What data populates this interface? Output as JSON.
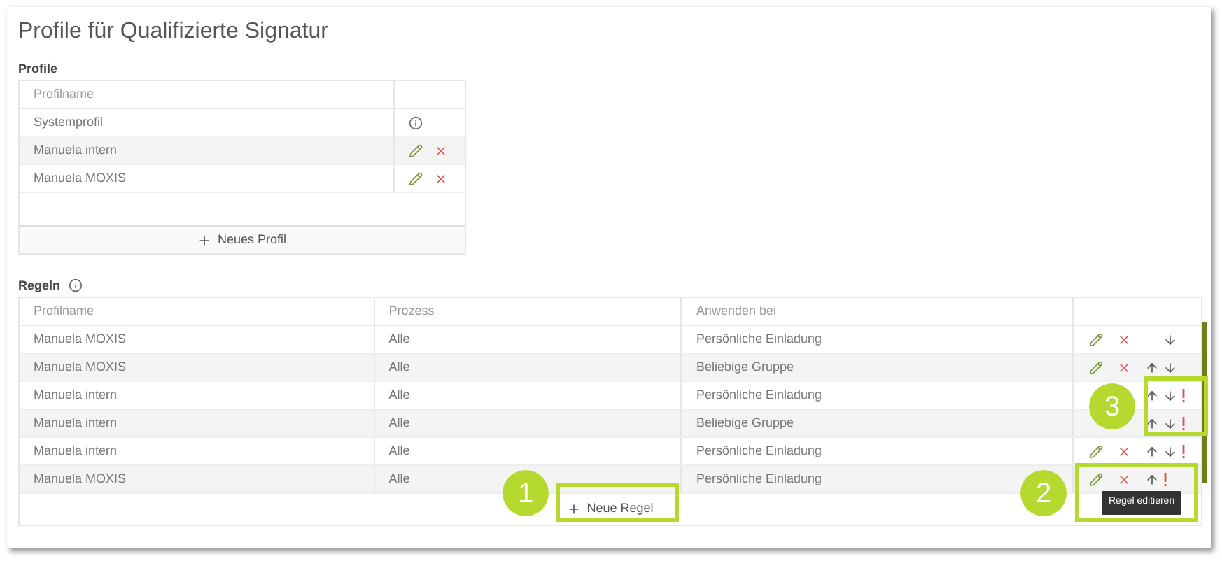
{
  "title": "Profile für Qualifizierte Signatur",
  "profiles": {
    "heading": "Profile",
    "columns": [
      "Profilname"
    ],
    "rows": [
      {
        "name": "Systemprofil",
        "kind": "system"
      },
      {
        "name": "Manuela intern",
        "kind": "editable"
      },
      {
        "name": "Manuela MOXIS",
        "kind": "editable"
      }
    ],
    "add_button": "Neues Profil"
  },
  "rules": {
    "heading": "Regeln",
    "columns": [
      "Profilname",
      "Prozess",
      "Anwenden bei"
    ],
    "rows": [
      {
        "profile": "Manuela MOXIS",
        "process": "Alle",
        "apply": "Persönliche Einladung",
        "up": false,
        "down": true,
        "warning": false
      },
      {
        "profile": "Manuela MOXIS",
        "process": "Alle",
        "apply": "Beliebige Gruppe",
        "up": true,
        "down": true,
        "warning": false
      },
      {
        "profile": "Manuela intern",
        "process": "Alle",
        "apply": "Persönliche Einladung",
        "up": true,
        "down": true,
        "warning": true,
        "edit_visible": false
      },
      {
        "profile": "Manuela intern",
        "process": "Alle",
        "apply": "Beliebige Gruppe",
        "up": true,
        "down": true,
        "warning": true,
        "edit_visible": false
      },
      {
        "profile": "Manuela intern",
        "process": "Alle",
        "apply": "Persönliche Einladung",
        "up": true,
        "down": true,
        "warning": true
      },
      {
        "profile": "Manuela MOXIS",
        "process": "Alle",
        "apply": "Persönliche Einladung",
        "up": true,
        "down": false,
        "warning": true
      }
    ],
    "add_button": "Neue Regel"
  },
  "tooltip": "Regel editieren",
  "callouts": [
    "1",
    "2",
    "3"
  ]
}
